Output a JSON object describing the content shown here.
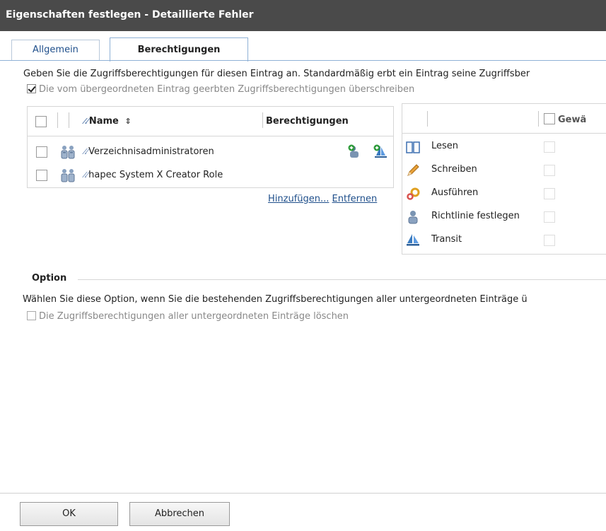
{
  "window": {
    "title": "Eigenschaften festlegen - Detaillierte Fehler"
  },
  "tabs": [
    {
      "label": "Allgemein"
    },
    {
      "label": "Berechtigungen"
    }
  ],
  "intro_text": "Geben Sie die Zugriffsberechtigungen für diesen Eintrag an. Standardmäßig erbt ein Eintrag seine Zugriffsber",
  "override_checkbox": {
    "label": "Die vom übergeordneten Eintrag geerbten Zugriffsberechtigungen überschreiben",
    "checked": true
  },
  "principals": {
    "headers": {
      "name": "Name",
      "permissions": "Berechtigungen"
    },
    "rows": [
      {
        "name": "Verzeichnisadministratoren",
        "icon": "group-admin-icon"
      },
      {
        "name": "hapec System X Creator Role",
        "icon": "group-icon"
      }
    ],
    "add_link": "Hinzufügen...",
    "remove_link": "Entfernen"
  },
  "permission_panel": {
    "header": "Gewä",
    "items": [
      {
        "label": "Lesen",
        "icon": "book-icon"
      },
      {
        "label": "Schreiben",
        "icon": "pencil-icon"
      },
      {
        "label": "Ausführen",
        "icon": "execute-icon"
      },
      {
        "label": "Richtlinie festlegen",
        "icon": "user-policy-icon"
      },
      {
        "label": "Transit",
        "icon": "boat-icon"
      }
    ]
  },
  "option": {
    "title": "Option",
    "text": "Wählen Sie diese Option, wenn Sie die bestehenden Zugriffsberechtigungen aller untergeordneten Einträge ü",
    "checkbox_label": "Die Zugriffsberechtigungen aller untergeordneten Einträge löschen"
  },
  "buttons": {
    "ok": "OK",
    "cancel": "Abbrechen"
  }
}
